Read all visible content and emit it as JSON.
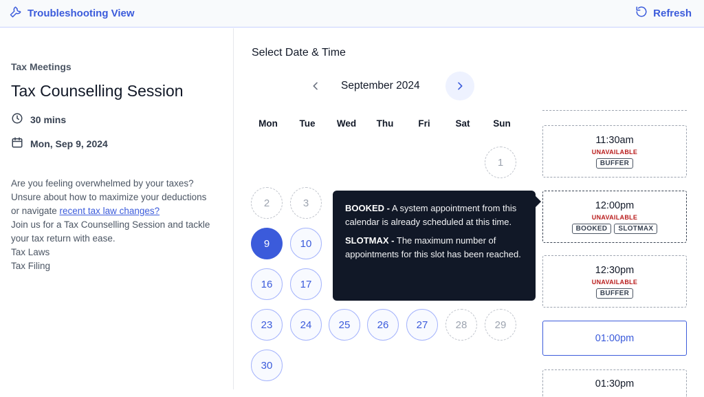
{
  "header": {
    "title": "Troubleshooting View",
    "refresh_label": "Refresh"
  },
  "event": {
    "category": "Tax Meetings",
    "title": "Tax Counselling Session",
    "duration": "30 mins",
    "date": "Mon, Sep 9, 2024",
    "description_part1": "Are you feeling overwhelmed by your taxes? Unsure about how to maximize your deductions or navigate ",
    "description_link": "recent tax law changes?",
    "description_part2": "Join us for a Tax Counselling Session and tackle your tax return with ease.",
    "tag1": "Tax Laws",
    "tag2": "Tax Filing"
  },
  "calendar": {
    "section_title": "Select Date & Time",
    "month_label": "September 2024",
    "weekdays": [
      "Mon",
      "Tue",
      "Wed",
      "Thu",
      "Fri",
      "Sat",
      "Sun"
    ],
    "days": {
      "d1": "1",
      "d2": "2",
      "d3": "3",
      "d9": "9",
      "d10": "10",
      "d16": "16",
      "d17": "17",
      "d23": "23",
      "d24": "24",
      "d25": "25",
      "d26": "26",
      "d27": "27",
      "d28": "28",
      "d29": "29",
      "d30": "30"
    }
  },
  "slots": [
    {
      "time": "11:30am",
      "status": "UNAVAILABLE",
      "badges": [
        "BUFFER"
      ]
    },
    {
      "time": "12:00pm",
      "status": "UNAVAILABLE",
      "badges": [
        "BOOKED",
        "SLOTMAX"
      ]
    },
    {
      "time": "12:30pm",
      "status": "UNAVAILABLE",
      "badges": [
        "BUFFER"
      ]
    },
    {
      "time": "01:00pm"
    },
    {
      "time": "01:30pm"
    }
  ],
  "tooltip": {
    "booked_term": "BOOKED -",
    "booked_text": " A system appointment from this calendar is already scheduled at this time.",
    "slotmax_term": "SLOTMAX -",
    "slotmax_text": " The maximum number of appointments for this slot has been reached."
  },
  "colors": {
    "accent": "#3b5bdb",
    "unavailable_status": "#b91c1c",
    "tooltip_bg": "#111827"
  }
}
